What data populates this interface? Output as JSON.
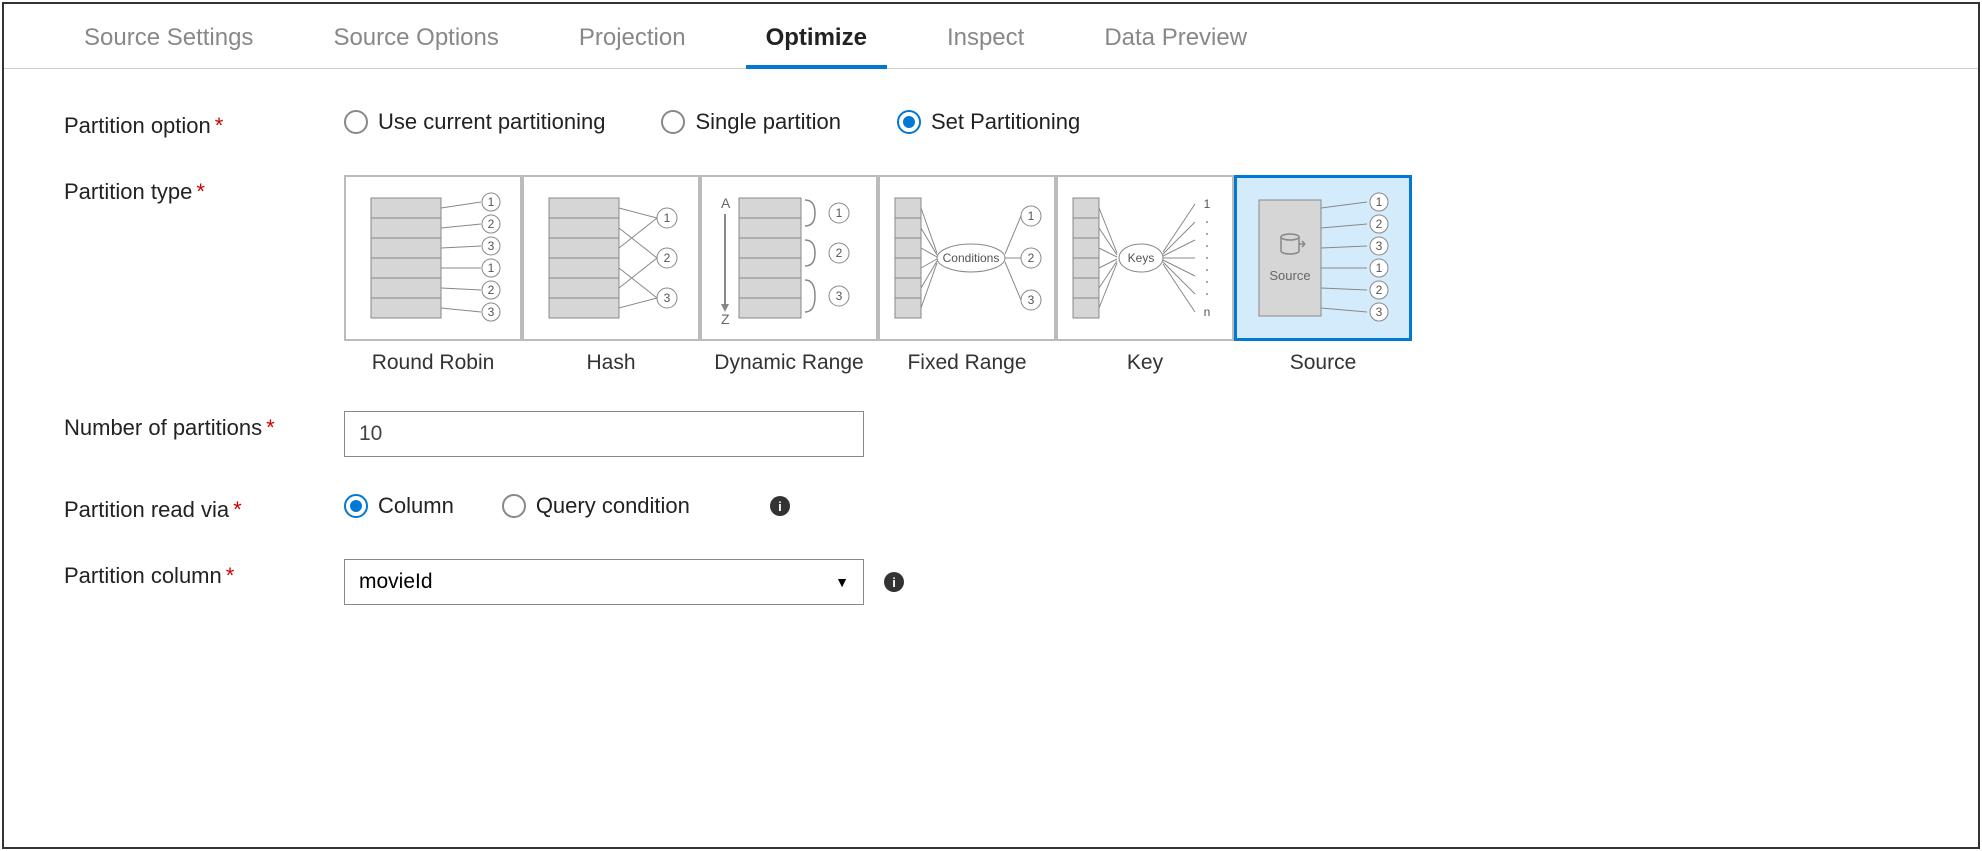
{
  "tabs": [
    {
      "label": "Source Settings",
      "active": false
    },
    {
      "label": "Source Options",
      "active": false
    },
    {
      "label": "Projection",
      "active": false
    },
    {
      "label": "Optimize",
      "active": true
    },
    {
      "label": "Inspect",
      "active": false
    },
    {
      "label": "Data Preview",
      "active": false
    }
  ],
  "fields": {
    "partition_option": {
      "label": "Partition option"
    },
    "partition_type": {
      "label": "Partition type"
    },
    "num_partitions": {
      "label": "Number of partitions",
      "value": "10"
    },
    "partition_read_via": {
      "label": "Partition read via"
    },
    "partition_column": {
      "label": "Partition column",
      "value": "movieId"
    }
  },
  "partition_option_radios": [
    {
      "label": "Use current partitioning",
      "selected": false
    },
    {
      "label": "Single partition",
      "selected": false
    },
    {
      "label": "Set Partitioning",
      "selected": true
    }
  ],
  "partition_types": [
    {
      "label": "Round Robin",
      "selected": false
    },
    {
      "label": "Hash",
      "selected": false
    },
    {
      "label": "Dynamic Range",
      "selected": false
    },
    {
      "label": "Fixed Range",
      "selected": false
    },
    {
      "label": "Key",
      "selected": false
    },
    {
      "label": "Source",
      "selected": true
    }
  ],
  "read_via_radios": [
    {
      "label": "Column",
      "selected": true
    },
    {
      "label": "Query condition",
      "selected": false
    }
  ],
  "diagram_labels": {
    "conditions": "Conditions",
    "keys": "Keys",
    "source": "Source",
    "a": "A",
    "z": "Z",
    "n": "n"
  }
}
